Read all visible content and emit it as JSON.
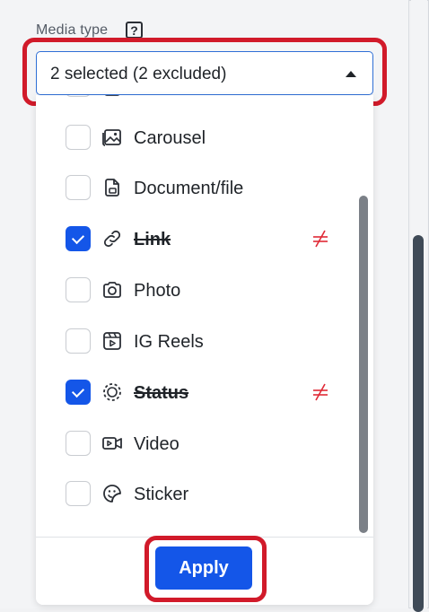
{
  "filter": {
    "label": "Media type",
    "help_icon": "question-square-icon",
    "select": {
      "value": "2 selected (2 excluded)",
      "state": "expanded"
    }
  },
  "options": [
    {
      "label": "Carousel",
      "icon": "carousel-icon",
      "checked": false,
      "excluded": false
    },
    {
      "label": "Document/file",
      "icon": "document-icon",
      "checked": false,
      "excluded": false
    },
    {
      "label": "Link",
      "icon": "link-icon",
      "checked": true,
      "excluded": true
    },
    {
      "label": "Photo",
      "icon": "camera-icon",
      "checked": false,
      "excluded": false
    },
    {
      "label": "IG Reels",
      "icon": "reels-icon",
      "checked": false,
      "excluded": false
    },
    {
      "label": "Status",
      "icon": "status-icon",
      "checked": true,
      "excluded": true
    },
    {
      "label": "Video",
      "icon": "video-icon",
      "checked": false,
      "excluded": false
    },
    {
      "label": "Sticker",
      "icon": "sticker-icon",
      "checked": false,
      "excluded": false
    }
  ],
  "footer": {
    "apply_label": "Apply"
  },
  "colors": {
    "accent": "#1456e8",
    "highlight": "#d11a2a",
    "excluded_marker": "#e02a36"
  }
}
